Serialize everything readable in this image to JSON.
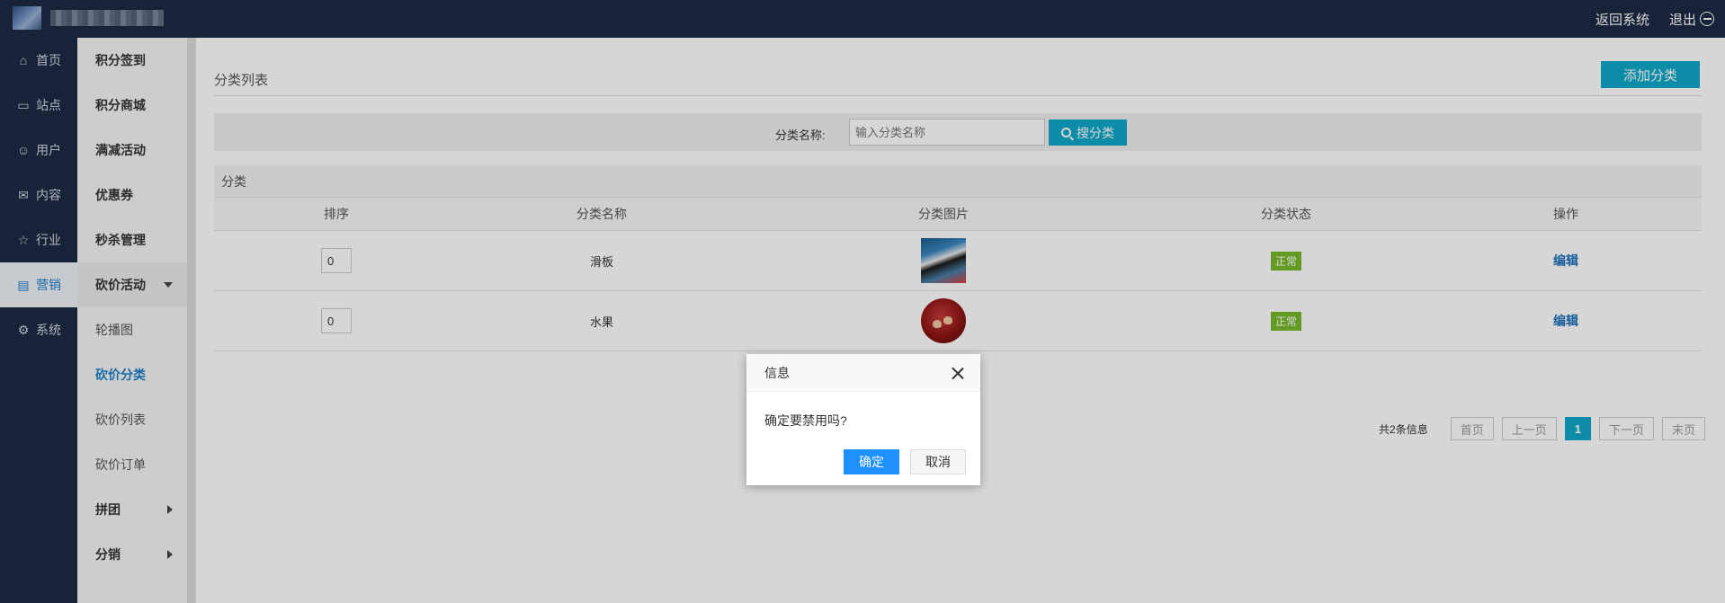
{
  "topbar": {
    "return_label": "返回系统",
    "logout_label": "退出"
  },
  "leftnav": [
    {
      "label": "首页",
      "icon": "home-icon"
    },
    {
      "label": "站点",
      "icon": "monitor-icon"
    },
    {
      "label": "用户",
      "icon": "user-icon"
    },
    {
      "label": "内容",
      "icon": "inbox-icon"
    },
    {
      "label": "行业",
      "icon": "star-icon"
    },
    {
      "label": "营销",
      "icon": "wallet-icon"
    },
    {
      "label": "系统",
      "icon": "gear-icon"
    }
  ],
  "subnav": [
    {
      "label": "积分签到"
    },
    {
      "label": "积分商城"
    },
    {
      "label": "满减活动"
    },
    {
      "label": "优惠券"
    },
    {
      "label": "秒杀管理"
    },
    {
      "label": "砍价活动"
    },
    {
      "label": "轮播图"
    },
    {
      "label": "砍价分类"
    },
    {
      "label": "砍价列表"
    },
    {
      "label": "砍价订单"
    },
    {
      "label": "拼团"
    },
    {
      "label": "分销"
    }
  ],
  "main": {
    "title": "分类列表",
    "add_button": "添加分类",
    "search": {
      "label": "分类名称:",
      "placeholder": "输入分类名称",
      "button": "搜分类"
    },
    "table": {
      "caption": "分类",
      "headers": [
        "排序",
        "分类名称",
        "分类图片",
        "分类状态",
        "操作"
      ],
      "rows": [
        {
          "sort": "0",
          "name": "滑板",
          "status": "正常",
          "action": "编辑"
        },
        {
          "sort": "0",
          "name": "水果",
          "status": "正常",
          "action": "编辑"
        }
      ]
    },
    "pager": {
      "info": "共2条信息",
      "first": "首页",
      "prev": "上一页",
      "current": "1",
      "next": "下一页",
      "last": "末页"
    }
  },
  "dialog": {
    "title": "信息",
    "message": "确定要禁用吗?",
    "ok": "确定",
    "cancel": "取消"
  },
  "colors": {
    "topbar": "#1d2a44",
    "accent": "#10a7c7",
    "status_ok": "#76b82a",
    "dialog_ok": "#1e90ff",
    "nav_active_text": "#1e7fc7"
  }
}
